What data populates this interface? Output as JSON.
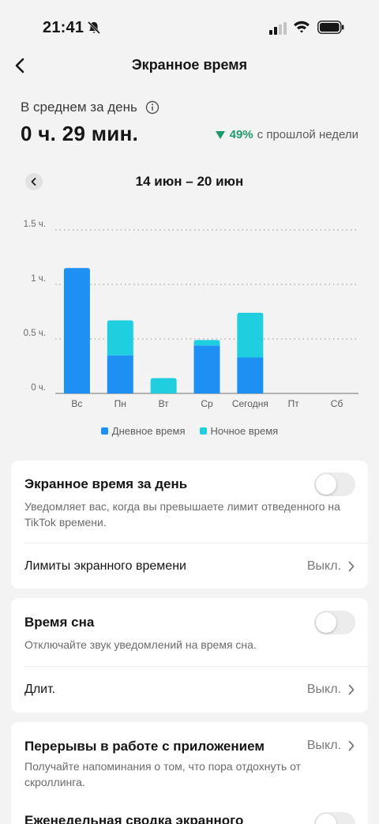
{
  "status_bar": {
    "time": "21:41",
    "icons": [
      "bell-muted-icon",
      "signal-icon",
      "wifi-icon",
      "battery-icon"
    ]
  },
  "header": {
    "title": "Экранное время",
    "back_icon": "chevron-left-icon"
  },
  "summary": {
    "avg_label": "В среднем за день",
    "avg_value": "0 ч. 29 мин.",
    "trend_percent": "49%",
    "trend_text": "с прошлой недели",
    "trend_direction": "down",
    "trend_color": "#1f9b6b"
  },
  "week": {
    "range": "14 июн – 20 июн",
    "prev_icon": "chevron-left-icon"
  },
  "chart_data": {
    "type": "bar",
    "stacked": true,
    "categories": [
      "Вс",
      "Пн",
      "Вт",
      "Ср",
      "Сегодня",
      "Пт",
      "Сб"
    ],
    "y_ticks": [
      "0 ч.",
      "0.5 ч.",
      "1 ч.",
      "1.5 ч."
    ],
    "ylim": [
      0,
      1.5
    ],
    "grid": true,
    "series": [
      {
        "name": "Дневное время",
        "color": "#1e90f4",
        "values": [
          1.15,
          0.35,
          0,
          0.44,
          0.33,
          0,
          0
        ]
      },
      {
        "name": "Ночное время",
        "color": "#1fcfe0",
        "values": [
          0,
          0.32,
          0.14,
          0.05,
          0.41,
          0,
          0
        ]
      }
    ],
    "legend_position": "bottom"
  },
  "settings": {
    "daily_screen_time": {
      "title": "Экранное время за день",
      "description": "Уведомляет вас, когда вы превышаете лимит отведенного на TikTok времени.",
      "enabled": false
    },
    "limits": {
      "label": "Лимиты экранного времени",
      "value": "Выкл."
    },
    "sleep_time": {
      "title": "Время сна",
      "description": "Отключайте звук уведомлений на время сна.",
      "enabled": false
    },
    "duration": {
      "label": "Длит.",
      "value": "Выкл."
    },
    "breaks": {
      "title": "Перерывы в работе с приложением",
      "value": "Выкл.",
      "description": "Получайте напоминания о том, что пора отдохнуть от скроллинга."
    },
    "weekly_summary": {
      "title": "Еженедельная сводка экранного",
      "enabled": false
    }
  }
}
